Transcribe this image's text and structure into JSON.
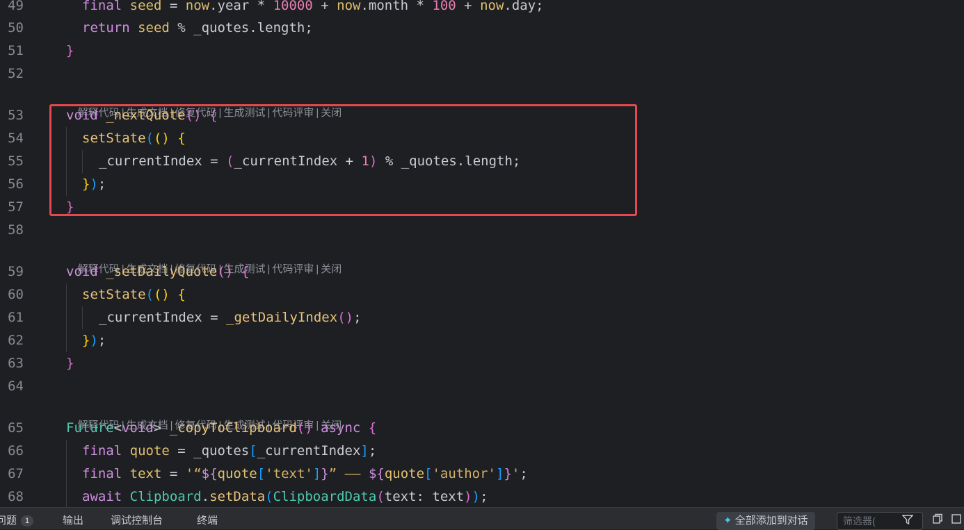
{
  "editor": {
    "lens_actions": [
      "解释代码",
      "生成文档",
      "修复代码",
      "生成测试",
      "代码评审",
      "关闭"
    ],
    "line_numbers": [
      "49",
      "50",
      "51",
      "52",
      "53",
      "54",
      "55",
      "56",
      "57",
      "58",
      "59",
      "60",
      "61",
      "62",
      "63",
      "64",
      "65",
      "66",
      "67",
      "68"
    ]
  },
  "bottom_panel": {
    "tabs": [
      {
        "label": "问题",
        "badge": "1"
      },
      {
        "label": "输出"
      },
      {
        "label": "调试控制台"
      },
      {
        "label": "终端"
      }
    ],
    "add_all_label": "全部添加到对话",
    "filter_placeholder": "筛选器(",
    "icons": [
      "sparkle-icon",
      "filter-icon",
      "copy-icon",
      "panel-icon"
    ]
  },
  "colors": {
    "highlight_box": "#e5484d",
    "background": "#1e1f22"
  }
}
